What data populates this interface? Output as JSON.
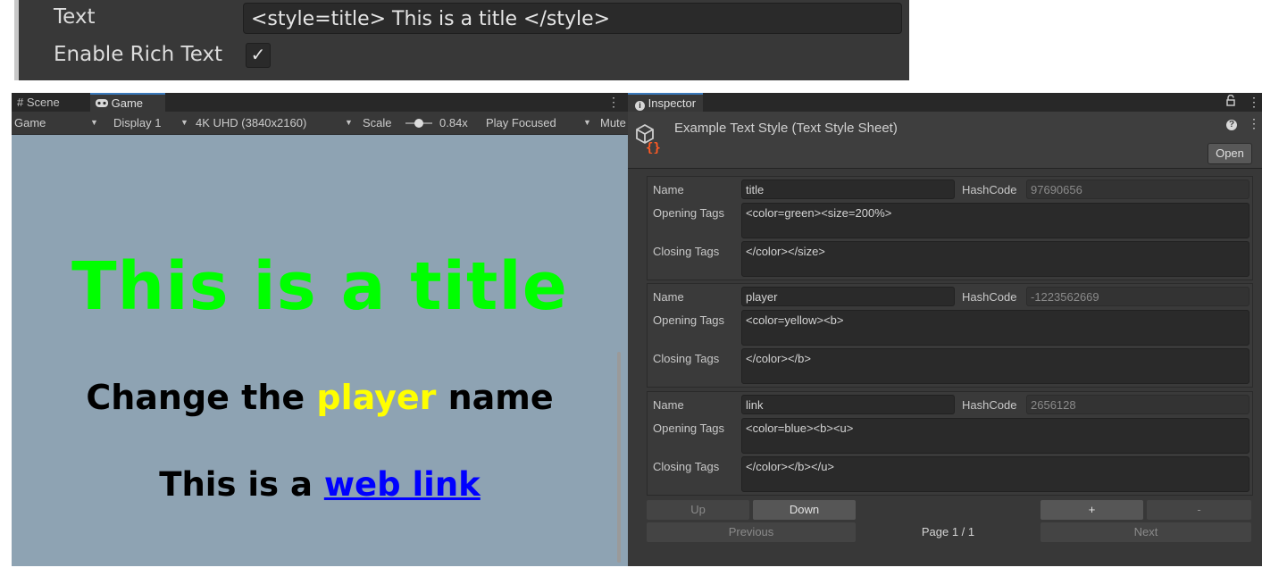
{
  "top_inspector": {
    "text_label": "Text",
    "text_value": "<style=title> This is a title </style>",
    "rich_text_label": "Enable Rich Text",
    "rich_text_checked": "✓"
  },
  "game_panel": {
    "tabs": [
      {
        "label": "Scene",
        "icon": "grid-icon"
      },
      {
        "label": "Game",
        "icon": "gamepad-icon"
      }
    ],
    "menu_icon": "⋮",
    "toolbar": {
      "mode": "Game",
      "display": "Display 1",
      "resolution": "4K UHD (3840x2160)",
      "scale_label": "Scale",
      "scale_value": "0.84x",
      "play_mode": "Play Focused",
      "mute": "Mute"
    },
    "viewport": {
      "title_text": "This is a title",
      "change_prefix": "Change the",
      "player_word": "player",
      "change_suffix": "name",
      "link_prefix": "This is a",
      "link_word": "web link",
      "colors": {
        "background": "#8ea3b3",
        "title": "#00ff00",
        "player": "#ffff00",
        "link": "#0000ff"
      }
    }
  },
  "inspector": {
    "tab_label": "Inspector",
    "asset_title": "Example Text Style (Text Style Sheet)",
    "open_label": "Open",
    "labels": {
      "name": "Name",
      "hashcode": "HashCode",
      "opening": "Opening Tags",
      "closing": "Closing Tags"
    },
    "styles": [
      {
        "name": "title",
        "hashcode": "97690656",
        "opening": "<color=green><size=200%>",
        "closing": "</color></size>"
      },
      {
        "name": "player",
        "hashcode": "-1223562669",
        "opening": "<color=yellow><b>",
        "closing": "</color></b>"
      },
      {
        "name": "link",
        "hashcode": "2656128",
        "opening": "<color=blue><b><u>",
        "closing": "</color></b></u>"
      }
    ],
    "buttons": {
      "up": "Up",
      "down": "Down",
      "add": "+",
      "remove": "-",
      "previous": "Previous",
      "page": "Page 1 / 1",
      "next": "Next"
    }
  }
}
